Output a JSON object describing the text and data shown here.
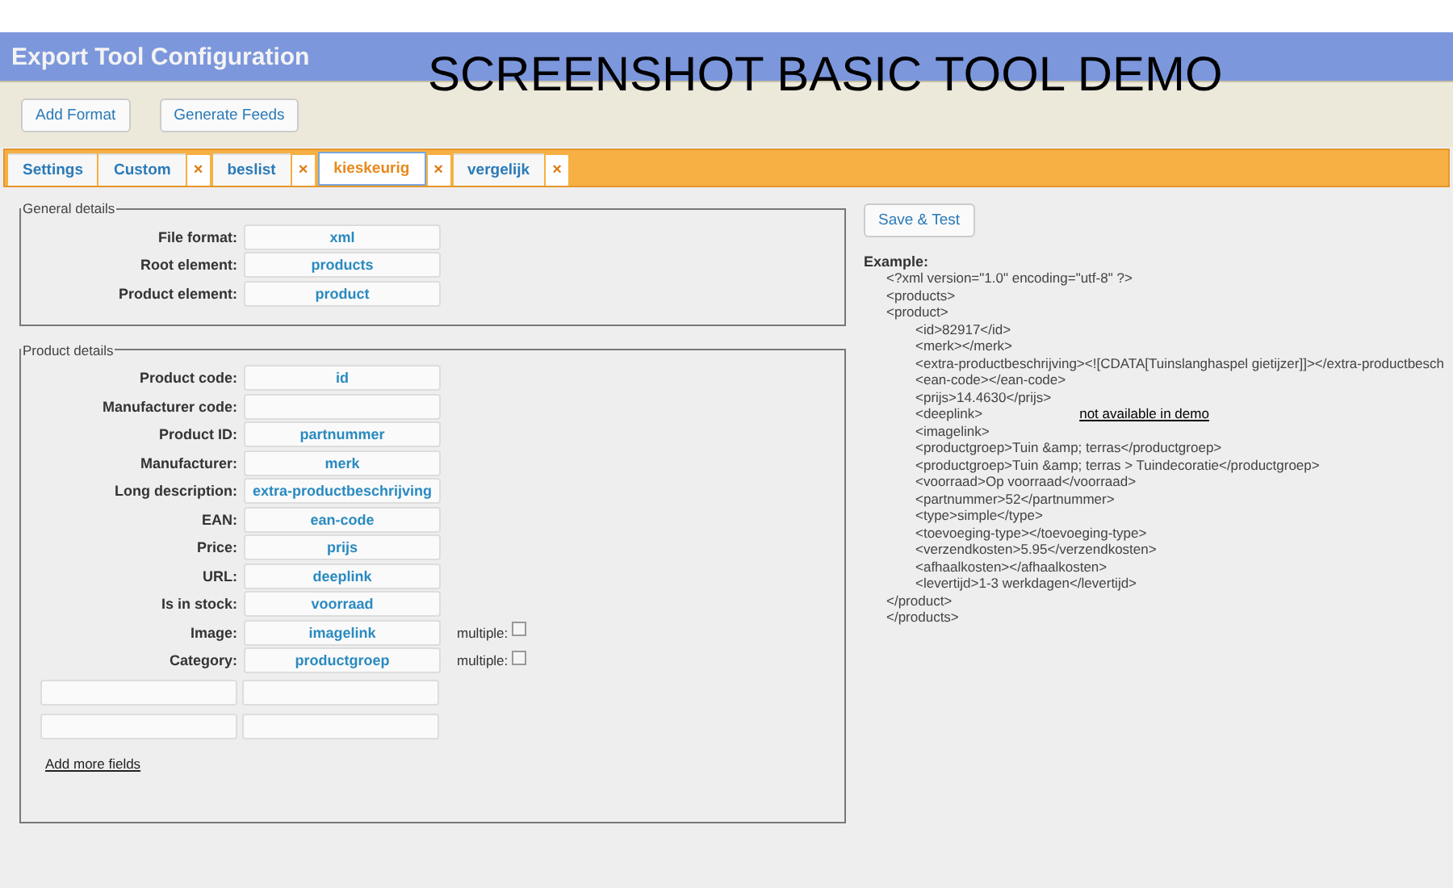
{
  "header": {
    "title": "Export Tool Configuration",
    "overlay_caption": "SCREENSHOT BASIC TOOL DEMO"
  },
  "toolbar": [
    "Add Format",
    "Generate Feeds"
  ],
  "tabs": [
    {
      "label": "Settings",
      "selected": false
    },
    {
      "label": "Custom",
      "selected": false,
      "close": "×"
    },
    {
      "label": "beslist",
      "selected": false,
      "close": "×"
    },
    {
      "label": "kieskeurig",
      "selected": true,
      "close": "×"
    },
    {
      "label": "vergelijk",
      "selected": false,
      "close": "×"
    }
  ],
  "general": {
    "legend": "General details",
    "fields": [
      {
        "label": "File format:",
        "value": "xml"
      },
      {
        "label": "Root element:",
        "value": "products"
      },
      {
        "label": "Product element:",
        "value": "product"
      }
    ]
  },
  "product": {
    "legend": "Product details",
    "fields": [
      {
        "label": "Product code:",
        "value": "id",
        "kind": "plain"
      },
      {
        "label": "Manufacturer code:",
        "kind": "plain"
      },
      {
        "label": "Product ID:",
        "value": "partnummer",
        "kind": "plain"
      },
      {
        "label": "Manufacturer:",
        "value": "merk",
        "kind": "plain"
      },
      {
        "label": "Long description:",
        "value": "extra-productbeschrijving",
        "kind": "plain"
      },
      {
        "label": "EAN:",
        "value": "ean-code",
        "kind": "plain"
      },
      {
        "label": "Price:",
        "value": "prijs",
        "kind": "plain"
      },
      {
        "label": "URL:",
        "value": "deeplink",
        "kind": "plain"
      },
      {
        "label": "Is in stock:",
        "value": "voorraad",
        "kind": "plain"
      },
      {
        "label": "Image:",
        "value": "imagelink",
        "kind": "multiple",
        "multiple_label": "multiple:",
        "checked": false
      },
      {
        "label": "Category:",
        "value": "productgroep",
        "kind": "multiple",
        "multiple_label": "multiple:",
        "checked": false
      }
    ],
    "extra_rows": [
      {
        "kind": "empty"
      },
      {
        "kind": "empty"
      }
    ],
    "add_link": "Add more fields"
  },
  "save_button": "Save & Test",
  "example": {
    "heading": "Example:",
    "lines": [
      {
        "text": "<?xml version=\"1.0\" encoding=\"utf-8\" ?>"
      },
      {
        "text": "<products>"
      },
      {
        "text": "<product>",
        "children": [
          {
            "text": "<id>82917</id>"
          },
          {
            "text": "<merk></merk>"
          },
          {
            "text": "<extra-productbeschrijving><![CDATA[Tuinslanghaspel gietijzer]]></extra-productbesch"
          },
          {
            "text": "<ean-code></ean-code>"
          },
          {
            "text": "<prijs>14.4630</prijs>"
          },
          {
            "text": "<deeplink>",
            "note": "not available in demo"
          },
          {
            "text": "<imagelink>"
          },
          {
            "text": "<productgroep>Tuin &amp; terras</productgroep>"
          },
          {
            "text": "<productgroep>Tuin &amp; terras > Tuindecoratie</productgroep>"
          },
          {
            "text": "<voorraad>Op voorraad</voorraad>"
          },
          {
            "text": "<partnummer>52</partnummer>"
          },
          {
            "text": "<type>simple</type>"
          },
          {
            "text": "<toevoeging-type></toevoeging-type>"
          },
          {
            "text": "<verzendkosten>5.95</verzendkosten>"
          },
          {
            "text": "<afhaalkosten></afhaalkosten>"
          },
          {
            "text": "<levertijd>1-3 werkdagen</levertijd>"
          }
        ]
      },
      {
        "text": "</product>"
      },
      {
        "text": "</products>"
      }
    ]
  }
}
